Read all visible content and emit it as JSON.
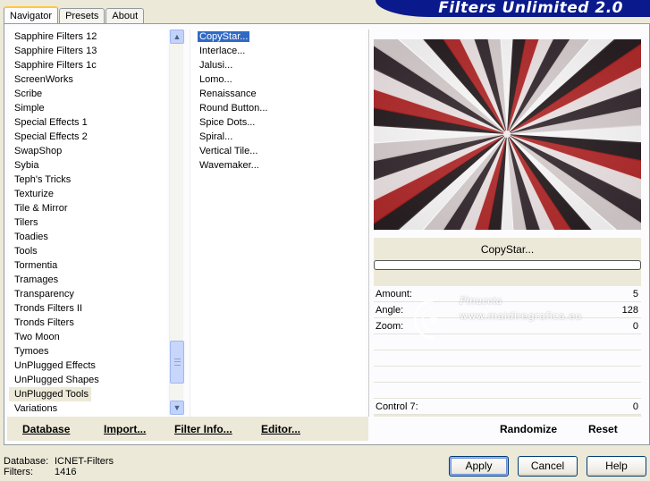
{
  "app": {
    "title": "Filters Unlimited 2.0"
  },
  "tabs": [
    {
      "label": "Navigator",
      "active": true
    },
    {
      "label": "Presets",
      "active": false
    },
    {
      "label": "About",
      "active": false
    }
  ],
  "categories": {
    "items": [
      "Sapphire Filters 12",
      "Sapphire Filters 13",
      "Sapphire Filters 1c",
      "ScreenWorks",
      "Scribe",
      "Simple",
      "Special Effects 1",
      "Special Effects 2",
      "SwapShop",
      "Sybia",
      "Teph's Tricks",
      "Texturize",
      "Tile & Mirror",
      "Tilers",
      "Toadies",
      "Tools",
      "Tormentia",
      "Tramages",
      "Transparency",
      "Tronds Filters II",
      "Tronds Filters",
      "Two Moon",
      "Tymoes",
      "UnPlugged Effects",
      "UnPlugged Shapes",
      "UnPlugged Tools",
      "Variations"
    ],
    "selected": "UnPlugged Tools"
  },
  "filters": {
    "items": [
      "CopyStar...",
      "Interlace...",
      "Jalusi...",
      "Lomo...",
      "Renaissance",
      "Round Button...",
      "Spice Dots...",
      "Spiral...",
      "Vertical Tile...",
      "Wavemaker..."
    ],
    "selected": "CopyStar..."
  },
  "left_buttons": {
    "database": "Database",
    "import": "Import...",
    "filter_info": "Filter Info...",
    "editor": "Editor..."
  },
  "preview": {
    "filter_name": "CopyStar..."
  },
  "params": [
    {
      "label": "Amount:",
      "value": "5"
    },
    {
      "label": "Angle:",
      "value": "128"
    },
    {
      "label": "Zoom:",
      "value": "0"
    },
    {
      "label": "",
      "value": ""
    },
    {
      "label": "",
      "value": ""
    },
    {
      "label": "",
      "value": ""
    },
    {
      "label": "",
      "value": ""
    },
    {
      "label": "Control 7:",
      "value": "0"
    }
  ],
  "right_buttons": {
    "randomize": "Randomize",
    "reset": "Reset"
  },
  "status": {
    "database_label": "Database:",
    "database_value": "ICNET-Filters",
    "filters_label": "Filters:",
    "filters_value": "1416"
  },
  "dialog_buttons": {
    "apply": "Apply",
    "cancel": "Cancel",
    "help": "Help"
  },
  "watermark": {
    "name": "Pinuccia",
    "url": "www.maidiregrafica.eu"
  },
  "colors": {
    "title_bar": "#0a1a8c",
    "selection": "#316ac5",
    "tab_highlight": "#ffc83c",
    "window_bg": "#ece9d8"
  }
}
